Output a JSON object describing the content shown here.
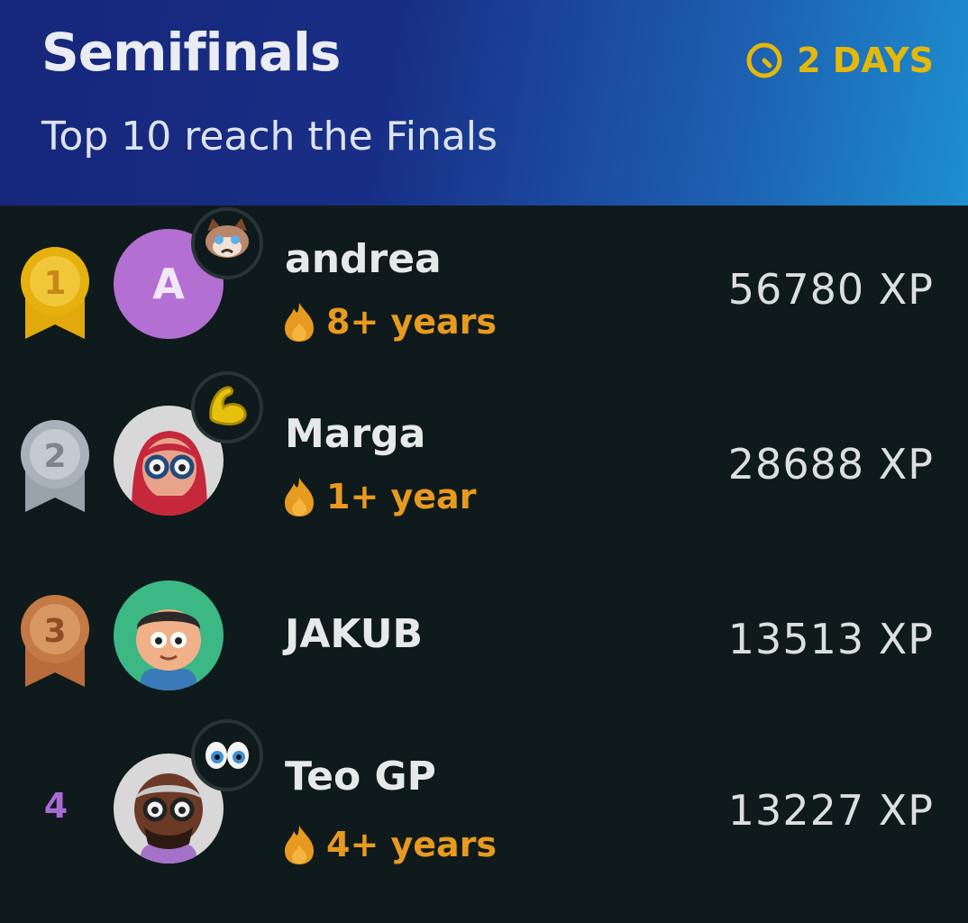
{
  "header": {
    "title": "Semifinals",
    "subtitle": "Top 10 reach the Finals",
    "timer_label": "2 DAYS"
  },
  "rows": [
    {
      "rank": "1",
      "avatar_letter": "A",
      "name": "andrea",
      "streak": "8+ years",
      "xp": "56780 XP"
    },
    {
      "rank": "2",
      "name": "Marga",
      "streak": "1+ year",
      "xp": "28688 XP"
    },
    {
      "rank": "3",
      "name": "JAKUB",
      "xp": "13513 XP"
    },
    {
      "rank": "4",
      "name": "Teo GP",
      "streak": "4+ years",
      "xp": "13227 XP"
    }
  ],
  "colors": {
    "gold": "#e6b00f",
    "silver": "#a9b2ba",
    "bronze": "#c47a45",
    "accent_timer": "#e5b80b",
    "streak": "#e79a20",
    "rank_four": "#a96ad6"
  },
  "icons": {
    "timer": "clock-icon",
    "streak": "flame-icon",
    "medal": "medal-icon",
    "badge_1": "grumpy-cat-badge-icon",
    "badge_2": "strong-arm-badge-icon",
    "badge_4": "eyes-badge-icon"
  }
}
